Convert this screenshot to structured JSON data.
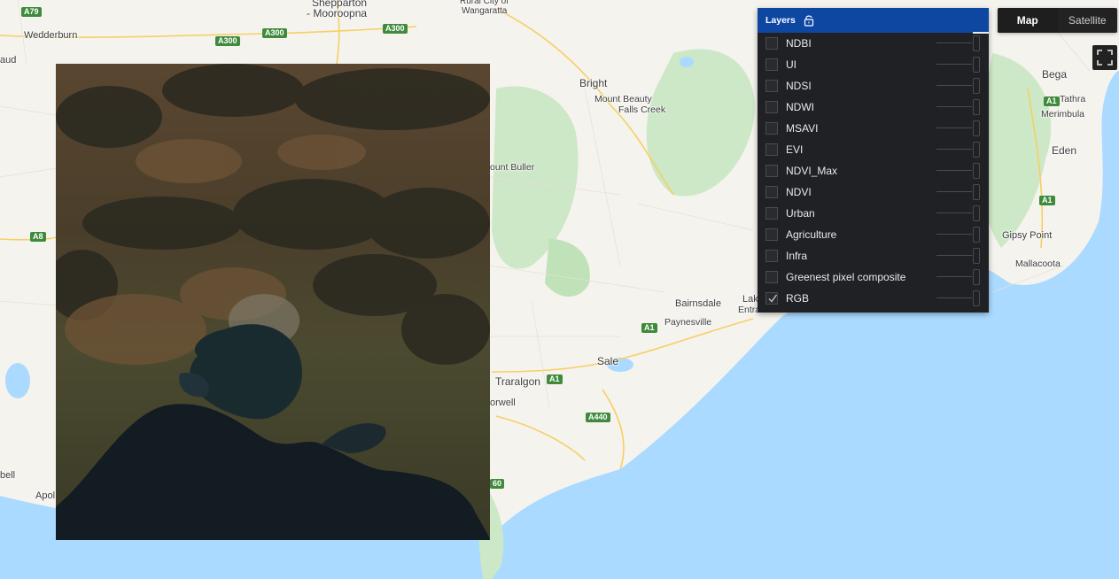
{
  "map": {
    "places": [
      {
        "name": "Wedderburn"
      },
      {
        "name": "aud"
      },
      {
        "name": "Shepparton"
      },
      {
        "name": "- Mooroopna"
      },
      {
        "name": "Rural City of"
      },
      {
        "name": "Wangaratta"
      },
      {
        "name": "Bright"
      },
      {
        "name": "Mount Beauty"
      },
      {
        "name": "Falls Creek"
      },
      {
        "name": "ount Buller"
      },
      {
        "name": "Bega"
      },
      {
        "name": "Tathra"
      },
      {
        "name": "Merimbula"
      },
      {
        "name": "Eden"
      },
      {
        "name": "Gipsy Point"
      },
      {
        "name": "Mallacoota"
      },
      {
        "name": "Bairnsdale"
      },
      {
        "name": "Lak"
      },
      {
        "name": "Entra"
      },
      {
        "name": "Paynesville"
      },
      {
        "name": "Sale"
      },
      {
        "name": "Traralgon"
      },
      {
        "name": "orwell"
      },
      {
        "name": "bell"
      },
      {
        "name": "Apol"
      }
    ],
    "shields": [
      {
        "label": "A79"
      },
      {
        "label": "A300"
      },
      {
        "label": "A300"
      },
      {
        "label": "A300"
      },
      {
        "label": "A1"
      },
      {
        "label": "A1"
      },
      {
        "label": "A8"
      },
      {
        "label": "A1"
      },
      {
        "label": "A1"
      },
      {
        "label": "A440"
      },
      {
        "label": "60"
      }
    ]
  },
  "map_type": {
    "options": [
      "Map",
      "Satellite"
    ],
    "selected": "Map"
  },
  "layers_panel": {
    "title": "Layers",
    "layers": [
      {
        "label": "NDBI",
        "checked": false
      },
      {
        "label": "UI",
        "checked": false
      },
      {
        "label": "NDSI",
        "checked": false
      },
      {
        "label": "NDWI",
        "checked": false
      },
      {
        "label": "MSAVI",
        "checked": false
      },
      {
        "label": "EVI",
        "checked": false
      },
      {
        "label": "NDVI_Max",
        "checked": false
      },
      {
        "label": "NDVI",
        "checked": false
      },
      {
        "label": "Urban",
        "checked": false
      },
      {
        "label": "Agriculture",
        "checked": false
      },
      {
        "label": "Infra",
        "checked": false
      },
      {
        "label": "Greenest pixel composite",
        "checked": false
      },
      {
        "label": "RGB",
        "checked": true
      }
    ]
  },
  "colors": {
    "land": "#f5f3ee",
    "sea": "#aadaff",
    "park": "#cde8c7",
    "panel_bg": "#202124",
    "panel_header": "#0e47a1"
  }
}
